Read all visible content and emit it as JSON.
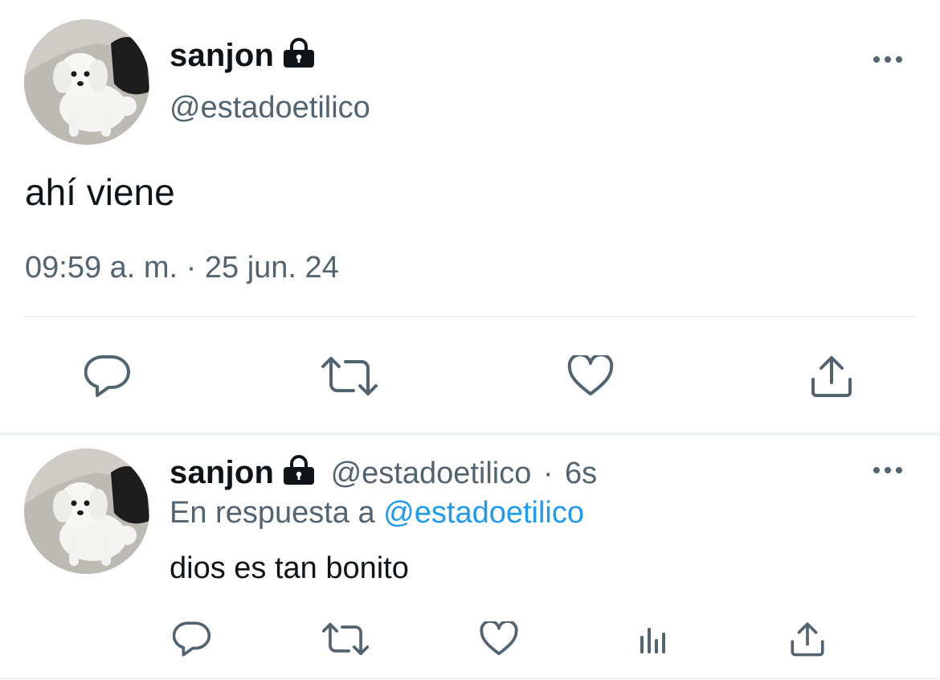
{
  "main_tweet": {
    "display_name": "sanjon",
    "handle": "@estadoetilico",
    "text": "ahí viene",
    "timestamp": "09:59 a. m. · 25 jun. 24"
  },
  "reply_tweet": {
    "display_name": "sanjon",
    "handle": "@estadoetilico",
    "separator": "·",
    "age": "6s",
    "reply_prefix": "En respuesta a",
    "reply_to": "@estadoetilico",
    "text": "dios es tan bonito"
  },
  "icons": {
    "lock": "lock-icon",
    "more": "more-horizontal-icon",
    "reply": "reply-icon",
    "retweet": "retweet-icon",
    "like": "heart-icon",
    "views": "views-icon",
    "share": "share-icon"
  },
  "colors": {
    "text": "#0f1419",
    "secondary": "#536471",
    "link": "#1d9bf0",
    "divider": "#eff3f4"
  }
}
